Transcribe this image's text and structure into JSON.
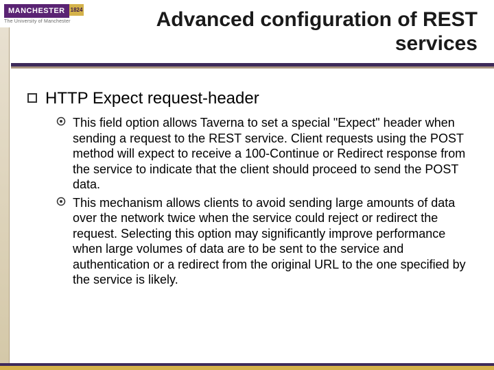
{
  "logo": {
    "name": "MANCHESTER",
    "year": "1824",
    "subtitle": "The University of Manchester"
  },
  "title": "Advanced configuration of REST services",
  "bullets": {
    "l1": "HTTP Expect request-header",
    "l2": [
      "This field option allows Taverna to set a special \"Expect\" header when sending a request to the REST service. Client requests using the POST method will expect to receive a 100-Continue or Redirect response from the service to indicate that the client should proceed to send the POST data.",
      "This mechanism allows clients to avoid sending large amounts of data over the network twice when the service could reject or redirect the request. Selecting this option may significantly improve performance when large volumes of data are to be sent to the service and authentication or a redirect from the original URL to the one specified by the service is likely."
    ]
  }
}
